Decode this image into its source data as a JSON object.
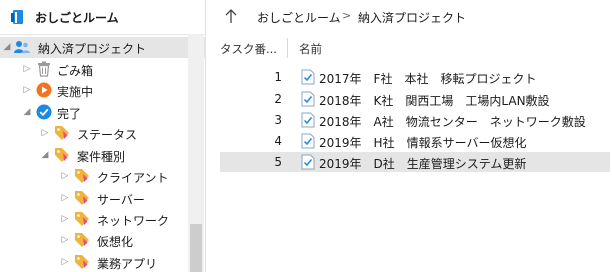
{
  "app": {
    "title": "おしごとルーム"
  },
  "tree": {
    "root": "納入済プロジェクト",
    "trash": "ごみ箱",
    "in_progress": "実施中",
    "done": "完了",
    "status": "ステータス",
    "category": "案件種別",
    "client": "クライアント",
    "server": "サーバー",
    "network": "ネットワーク",
    "virtualization": "仮想化",
    "business_app": "業務アプリ"
  },
  "breadcrumb": {
    "items": [
      "おしごとルーム",
      "納入済プロジェクト"
    ],
    "separator": ">"
  },
  "columns": {
    "task_no": "タスク番...",
    "name": "名前"
  },
  "tasks": [
    {
      "no": "1",
      "name": "2017年　F社　本社　移転プロジェクト"
    },
    {
      "no": "2",
      "name": "2018年　K社　関西工場　工場内LAN敷設"
    },
    {
      "no": "3",
      "name": "2018年　A社　物流センター　ネットワーク敷設"
    },
    {
      "no": "4",
      "name": "2019年　H社　情報系サーバー仮想化"
    },
    {
      "no": "5",
      "name": "2019年　D社　生産管理システム更新"
    }
  ],
  "colors": {
    "accent": "#1e88e5",
    "orange": "#f5741f",
    "tag": "#f2b33d",
    "selected": "#e5e5e5"
  }
}
